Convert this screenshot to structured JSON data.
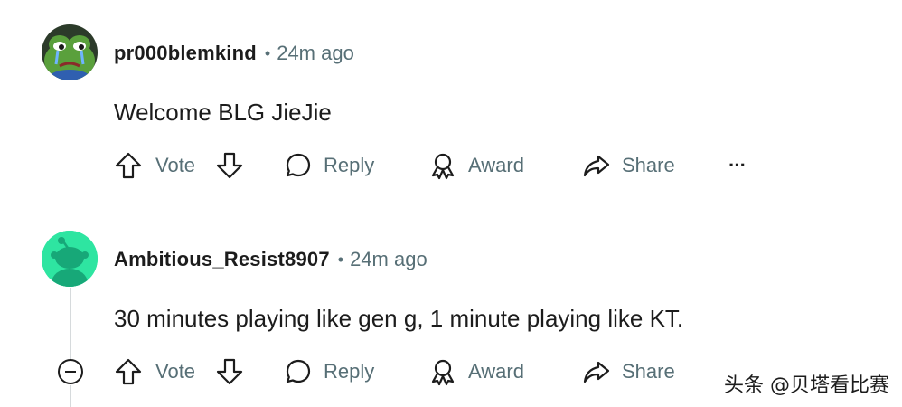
{
  "comments": [
    {
      "username": "pr000blemkind",
      "separator": "•",
      "time": "24m ago",
      "text": "Welcome BLG JieJie",
      "avatar_icon": "sad-frog-avatar",
      "actions": {
        "vote": "Vote",
        "reply": "Reply",
        "award": "Award",
        "share": "Share",
        "more": "···"
      }
    },
    {
      "username": "Ambitious_Resist8907",
      "separator": "•",
      "time": "24m ago",
      "text": "30 minutes playing like gen g, 1 minute playing like KT.",
      "avatar_icon": "snoo-default-avatar",
      "actions": {
        "vote": "Vote",
        "reply": "Reply",
        "award": "Award",
        "share": "Share"
      }
    }
  ],
  "watermark": "头条 @贝塔看比赛",
  "colors": {
    "text": "#1c1c1c",
    "muted": "#576f76",
    "thread": "#d6dadc",
    "snoo_bg": "#2ee5a1"
  }
}
